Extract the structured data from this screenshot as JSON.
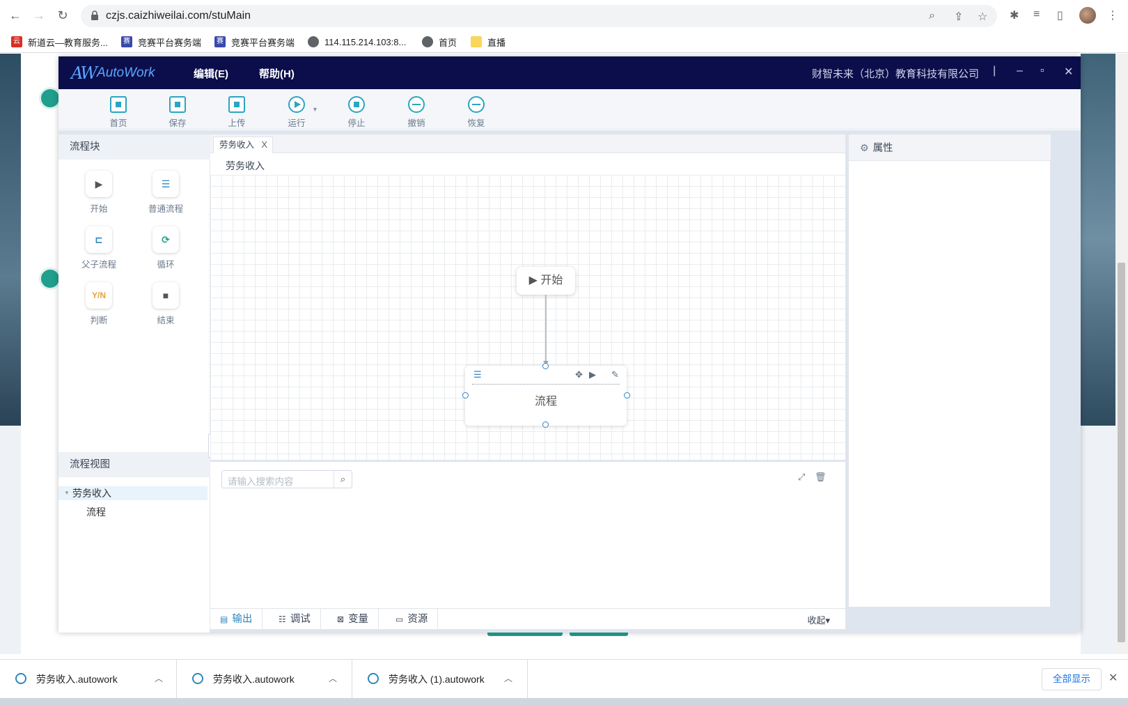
{
  "browser": {
    "url": "czjs.caizhiweilai.com/stuMain",
    "bookmarks": [
      {
        "label": "新道云—教育服务..."
      },
      {
        "label": "竞赛平台赛务端"
      },
      {
        "label": "竞赛平台赛务端"
      },
      {
        "label": "114.115.214.103:8..."
      },
      {
        "label": "首页"
      },
      {
        "label": "直播"
      }
    ]
  },
  "app": {
    "logo_mark": "AW",
    "logo_text": "AutoWork",
    "menu": [
      {
        "label": "编辑(E)"
      },
      {
        "label": "帮助(H)"
      }
    ],
    "company": "财智未来（北京）教育科技有限公司",
    "separator": "|",
    "win_min": "–",
    "win_max": "▫",
    "win_close": "✕",
    "ribbon": [
      {
        "label": "首页"
      },
      {
        "label": "保存"
      },
      {
        "label": "上传"
      },
      {
        "label": "运行"
      },
      {
        "label": "停止"
      },
      {
        "label": "撤销"
      },
      {
        "label": "恢复"
      }
    ],
    "blocks_title": "流程块",
    "blocks": [
      {
        "label": "开始",
        "glyph": "▶"
      },
      {
        "label": "普通流程",
        "glyph": "☰"
      },
      {
        "label": "父子流程",
        "glyph": "⊏"
      },
      {
        "label": "循环",
        "glyph": "⟳"
      },
      {
        "label": "判断",
        "glyph": "Y/N"
      },
      {
        "label": "结束",
        "glyph": "■"
      }
    ],
    "view_title": "流程视图",
    "tree": {
      "root": "劳务收入",
      "child": "流程"
    },
    "tab": {
      "label": "劳务收入",
      "close": "X"
    },
    "breadcrumb": "劳务收入",
    "canvas": {
      "start_label": "▶ 开始",
      "process_label": "流程"
    },
    "search_placeholder": "请输入搜索内容",
    "bottom_tabs": [
      {
        "label": "输出"
      },
      {
        "label": "调试"
      },
      {
        "label": "变量"
      },
      {
        "label": "资源"
      }
    ],
    "collapse_label": "收起▾",
    "properties_title": "属性"
  },
  "downloads": [
    {
      "name": "劳务收入.autowork"
    },
    {
      "name": "劳务收入.autowork"
    },
    {
      "name": "劳务收入 (1).autowork"
    }
  ],
  "show_all": "全部显示"
}
